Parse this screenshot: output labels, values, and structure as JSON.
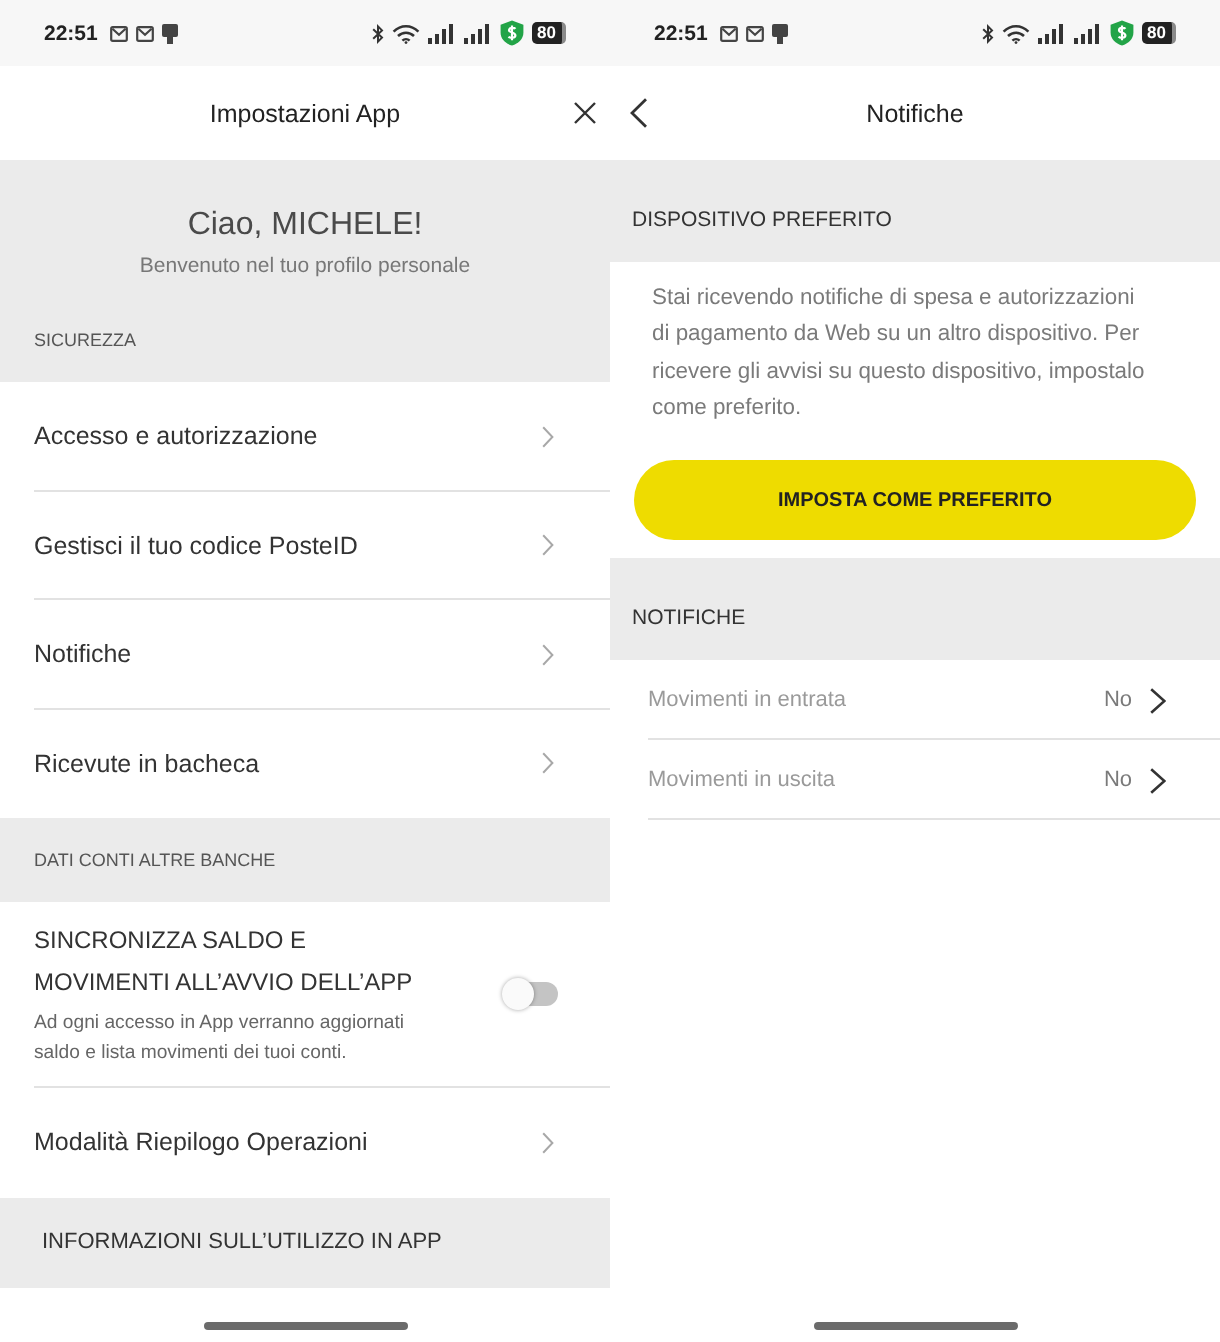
{
  "screens": [
    {
      "status_bar": {
        "time": "22:51",
        "battery": "80"
      },
      "header": {
        "kind": "modal",
        "title": "Impostazioni App"
      },
      "greeting": {
        "title": "Ciao, MICHELE!",
        "subtitle": "Benvenuto nel tuo profilo personale"
      },
      "sections": [
        {
          "kind": "caption",
          "heading": "SICUREZZA",
          "items": [
            {
              "kind": "link",
              "label": "Accesso e autorizzazione"
            },
            {
              "kind": "link",
              "label": "Gestisci il tuo codice PosteID"
            },
            {
              "kind": "link",
              "label": "Notifiche"
            },
            {
              "kind": "link",
              "label": "Ricevute in bacheca"
            }
          ]
        },
        {
          "kind": "caption",
          "heading": "DATI CONTI ALTRE BANCHE",
          "items": [
            {
              "kind": "toggle",
              "label": "SINCRONIZZA SALDO E MOVIMENTI ALL’AVVIO DELL’APP",
              "description": "Ad ogni accesso in App verranno aggiornati saldo e lista movimenti dei tuoi conti.",
              "on": false
            },
            {
              "kind": "link",
              "label": "Modalità Riepilogo Operazioni"
            }
          ]
        },
        {
          "kind": "group",
          "heading": "INFORMAZIONI SULL’UTILIZZO IN APP"
        }
      ]
    },
    {
      "status_bar": {
        "time": "22:51",
        "battery": "80"
      },
      "header": {
        "kind": "detail",
        "title": "Notifiche"
      },
      "sections": [
        {
          "kind": "title",
          "heading": "DISPOSITIVO PREFERITO",
          "notice": {
            "text": "Stai ricevendo notifiche di spesa e autorizzazioni di pagamento da Web su un altro dispositivo. Per ricevere gli avvisi su questo dispositivo, impostalo come preferito.",
            "button": "IMPOSTA COME PREFERITO"
          }
        },
        {
          "kind": "title",
          "heading": "NOTIFICHE",
          "items": [
            {
              "kind": "value",
              "label": "Movimenti in entrata",
              "value": "No"
            },
            {
              "kind": "value",
              "label": "Movimenti in uscita",
              "value": "No"
            }
          ]
        }
      ]
    }
  ]
}
